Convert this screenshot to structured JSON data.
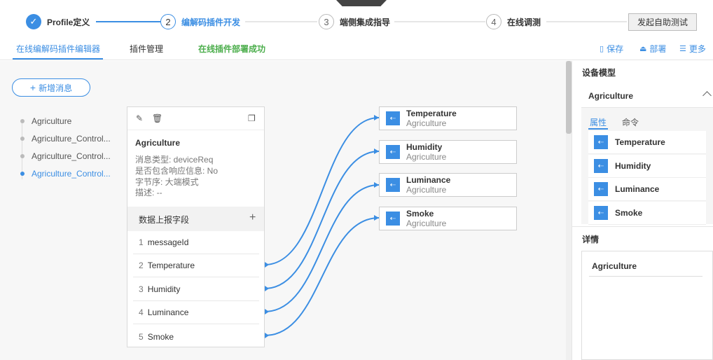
{
  "stepper": {
    "steps": [
      {
        "num": "✓",
        "label": "Profile定义",
        "state": "done"
      },
      {
        "num": "2",
        "label": "编解码插件开发",
        "state": "active"
      },
      {
        "num": "3",
        "label": "端侧集成指导",
        "state": "todo"
      },
      {
        "num": "4",
        "label": "在线调测",
        "state": "todo"
      }
    ],
    "test_button": "发起自助测试"
  },
  "tabs": {
    "items": [
      "在线编解码插件编辑器",
      "插件管理"
    ],
    "success_text": "在线插件部署成功",
    "actions": {
      "save": "保存",
      "deploy": "部署",
      "more": "更多"
    }
  },
  "canvas": {
    "add_message_button": "新增消息",
    "messages": [
      {
        "label": "Agriculture",
        "active": false
      },
      {
        "label": "Agriculture_Control...",
        "active": false
      },
      {
        "label": "Agriculture_Control...",
        "active": false
      },
      {
        "label": "Agriculture_Control...",
        "active": true
      }
    ],
    "message_card": {
      "title": "Agriculture",
      "type_line": "消息类型: deviceReq",
      "response_line": "是否包含响应信息: No",
      "byte_order_line": "字节序: 大端模式",
      "desc_line": "描述: --",
      "fields_header": "数据上报字段",
      "fields": [
        {
          "num": "1",
          "name": "messageId"
        },
        {
          "num": "2",
          "name": "Temperature"
        },
        {
          "num": "3",
          "name": "Humidity"
        },
        {
          "num": "4",
          "name": "Luminance"
        },
        {
          "num": "5",
          "name": "Smoke"
        }
      ]
    },
    "properties": [
      {
        "name": "Temperature",
        "service": "Agriculture"
      },
      {
        "name": "Humidity",
        "service": "Agriculture"
      },
      {
        "name": "Luminance",
        "service": "Agriculture"
      },
      {
        "name": "Smoke",
        "service": "Agriculture"
      }
    ]
  },
  "right_panel": {
    "device_model_title": "设备模型",
    "model_name": "Agriculture",
    "tab_properties": "属性",
    "tab_commands": "命令",
    "properties": [
      "Temperature",
      "Humidity",
      "Luminance",
      "Smoke"
    ],
    "details_title": "详情",
    "details_name": "Agriculture"
  },
  "colors": {
    "accent": "#3b8ee3",
    "success": "#4cae4c"
  }
}
